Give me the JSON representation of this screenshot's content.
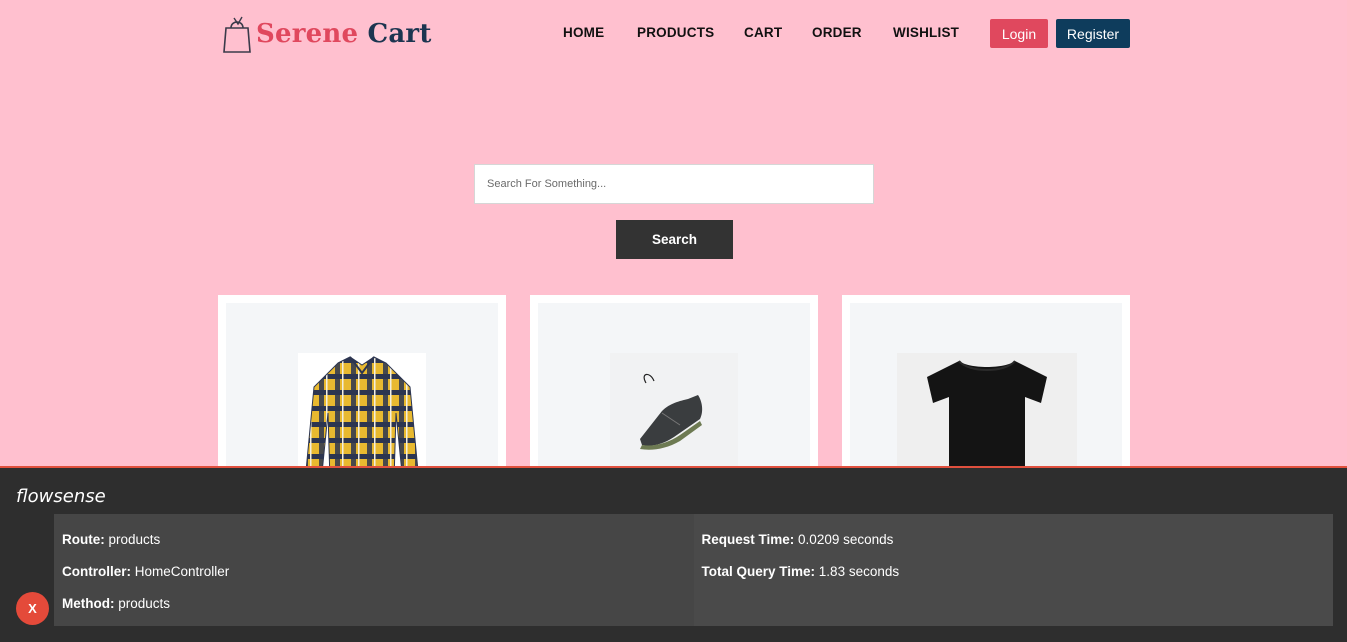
{
  "header": {
    "logo": {
      "word1": "Serene",
      "word2": "Cart",
      "icon": "shopping-bag-icon"
    },
    "nav": [
      "HOME",
      "PRODUCTS",
      "CART",
      "ORDER",
      "WISHLIST"
    ],
    "login_label": "Login",
    "register_label": "Register"
  },
  "search": {
    "placeholder": "Search For Something...",
    "button_label": "Search"
  },
  "products": [
    {
      "name": "plaid-flannel-shirt"
    },
    {
      "name": "black-sneaker"
    },
    {
      "name": "black-tshirt"
    }
  ],
  "debugbar": {
    "title": "flowsense",
    "route": {
      "label": "Route:",
      "value": "products"
    },
    "controller": {
      "label": "Controller:",
      "value": "HomeController"
    },
    "method": {
      "label": "Method:",
      "value": "products"
    },
    "request_time": {
      "label": "Request Time:",
      "value": "0.0209 seconds"
    },
    "query_time": {
      "label": "Total Query Time:",
      "value": "1.83 seconds"
    },
    "close_label": "X"
  },
  "colors": {
    "background": "#ffc0cf",
    "accent": "#e0485e",
    "navy": "#0e3c5c",
    "debug_bg": "#2e2e2e"
  }
}
